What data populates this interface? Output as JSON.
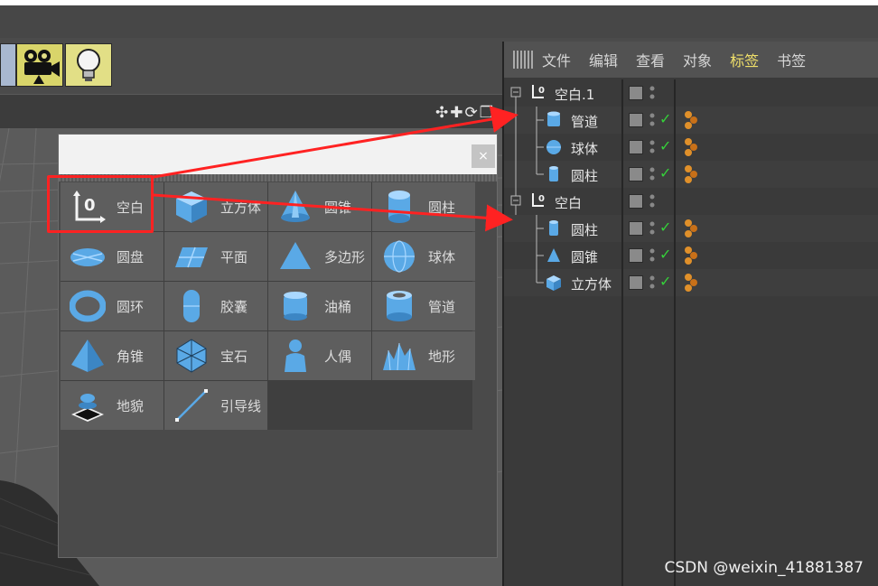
{
  "window": {
    "close_label": "×"
  },
  "viewport": {
    "nav_icons": "✣✚⟳❐"
  },
  "palette": {
    "items": [
      {
        "label": "空白",
        "icon": "null-object-icon"
      },
      {
        "label": "立方体",
        "icon": "cube-icon"
      },
      {
        "label": "圆锥",
        "icon": "cone-icon"
      },
      {
        "label": "圆柱",
        "icon": "cylinder-icon"
      },
      {
        "label": "圆盘",
        "icon": "disc-icon"
      },
      {
        "label": "平面",
        "icon": "plane-icon"
      },
      {
        "label": "多边形",
        "icon": "polygon-icon"
      },
      {
        "label": "球体",
        "icon": "sphere-icon"
      },
      {
        "label": "圆环",
        "icon": "torus-icon"
      },
      {
        "label": "胶囊",
        "icon": "capsule-icon"
      },
      {
        "label": "油桶",
        "icon": "oil-tank-icon"
      },
      {
        "label": "管道",
        "icon": "tube-icon"
      },
      {
        "label": "角锥",
        "icon": "pyramid-icon"
      },
      {
        "label": "宝石",
        "icon": "gem-icon"
      },
      {
        "label": "人偶",
        "icon": "figure-icon"
      },
      {
        "label": "地形",
        "icon": "landscape-icon"
      },
      {
        "label": "地貌",
        "icon": "relief-icon"
      },
      {
        "label": "引导线",
        "icon": "guide-line-icon"
      }
    ]
  },
  "object_manager": {
    "menu": [
      {
        "label": "文件",
        "active": false
      },
      {
        "label": "编辑",
        "active": false
      },
      {
        "label": "查看",
        "active": false
      },
      {
        "label": "对象",
        "active": false
      },
      {
        "label": "标签",
        "active": true
      },
      {
        "label": "书签",
        "active": false
      }
    ],
    "objects": [
      {
        "name": "空白.1",
        "icon": "null-object-icon",
        "child": false,
        "has_check": false
      },
      {
        "name": "管道",
        "icon": "tube-icon",
        "child": true,
        "has_check": true
      },
      {
        "name": "球体",
        "icon": "sphere-icon",
        "child": true,
        "has_check": true
      },
      {
        "name": "圆柱",
        "icon": "cylinder-icon",
        "child": true,
        "has_check": true
      },
      {
        "name": "空白",
        "icon": "null-object-icon",
        "child": false,
        "has_check": false
      },
      {
        "name": "圆柱",
        "icon": "cylinder-icon",
        "child": true,
        "has_check": true
      },
      {
        "name": "圆锥",
        "icon": "cone-icon",
        "child": true,
        "has_check": true
      },
      {
        "name": "立方体",
        "icon": "cube-icon",
        "child": true,
        "has_check": true
      }
    ]
  },
  "colors": {
    "annotation_red": "#ff2222",
    "active_menu": "#f0e06a",
    "check_green": "#35d03a",
    "icon_blue": "#5aa9e6"
  },
  "watermark": "CSDN @weixin_41881387"
}
